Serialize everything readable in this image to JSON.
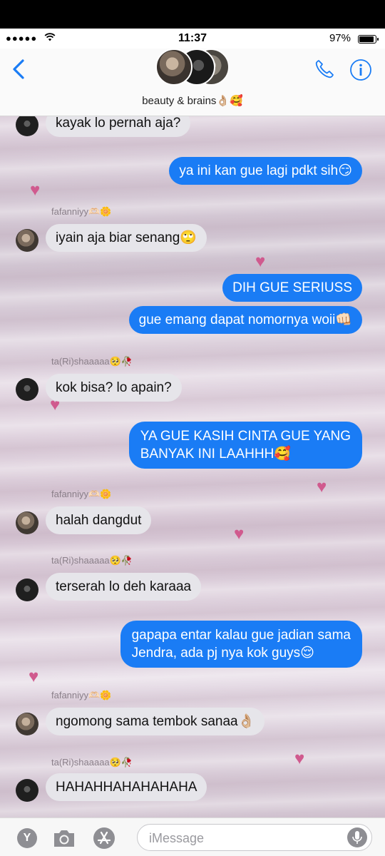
{
  "status_bar": {
    "signal": "●●●●●",
    "time": "11:37",
    "battery_percent": "97%",
    "battery_level": 0.97
  },
  "header": {
    "group_name": "beauty & brains👌🏼🥰"
  },
  "messages": [
    {
      "sender": "",
      "direction": "in",
      "text": "kayak lo pernah aja?"
    },
    {
      "sender": "",
      "direction": "out",
      "text": "ya ini kan gue lagi pdkt sih😏"
    },
    {
      "sender": "fafanniyy🫶🏻🌼",
      "direction": "in",
      "text": "iyain aja biar senang🙄"
    },
    {
      "sender": "",
      "direction": "out",
      "text": "DIH GUE SERIUSS"
    },
    {
      "sender": "",
      "direction": "out",
      "text": "gue emang dapat nomornya woii👊🏻"
    },
    {
      "sender": "ta(Ri)shaaaaa🥺🥀",
      "direction": "in",
      "text": "kok bisa? lo apain?"
    },
    {
      "sender": "",
      "direction": "out",
      "text": "YA GUE KASIH CINTA GUE YANG",
      "text2": "BANYAK INI LAAHHH🥰"
    },
    {
      "sender": "fafanniyy🫶🏻🌼",
      "direction": "in",
      "text": "halah dangdut"
    },
    {
      "sender": "ta(Ri)shaaaaa🥺🥀",
      "direction": "in",
      "text": "terserah lo deh karaaa"
    },
    {
      "sender": "",
      "direction": "out",
      "text": "gapapa entar kalau gue jadian sama",
      "text2": "Jendra, ada pj nya kok guys😌"
    },
    {
      "sender": "fafanniyy🫶🏻🌼",
      "direction": "in",
      "text": "ngomong sama tembok sanaa👌🏼"
    },
    {
      "sender": "ta(Ri)shaaaaa🥺🥀",
      "direction": "in",
      "text": "HAHAHHAHAHAHAHA"
    }
  ],
  "composer": {
    "placeholder": "iMessage",
    "app_store_letter": "Y"
  },
  "icons": [
    "back-chevron-icon",
    "phone-icon",
    "info-icon",
    "camera-icon",
    "app-store-icon",
    "microphone-icon",
    "heart-icon",
    "wifi-icon",
    "battery-icon"
  ],
  "colors": {
    "accent": "#1a7cf5",
    "outgoing_bubble": "#1a7cf5",
    "incoming_bubble": "#e6e5ea",
    "heart": "#d05a8e"
  }
}
